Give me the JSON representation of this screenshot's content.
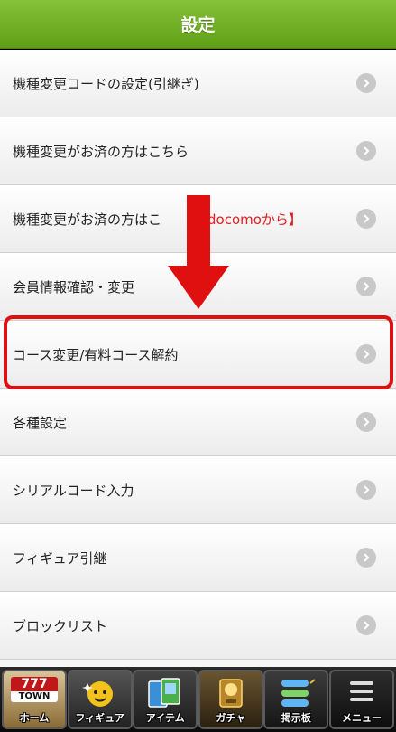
{
  "header": {
    "title": "設定"
  },
  "menu": {
    "items": [
      {
        "label": "機種変更コードの設定(引継ぎ)"
      },
      {
        "label": "機種変更がお済の方はこちら"
      },
      {
        "label": "機種変更がお済の方はこ",
        "extra": "【docomoから】"
      },
      {
        "label": "会員情報確認・変更"
      },
      {
        "label": "コース変更/有料コース解約"
      },
      {
        "label": "各種設定"
      },
      {
        "label": "シリアルコード入力"
      },
      {
        "label": "フィギュア引継"
      },
      {
        "label": "ブロックリスト"
      }
    ]
  },
  "tabbar": {
    "home": {
      "logo_top": "777",
      "logo_bottom": "TOWN",
      "label": "ホーム"
    },
    "figure": {
      "label": "フィギュア"
    },
    "item": {
      "label": "アイテム"
    },
    "gacha": {
      "label": "ガチャ"
    },
    "board": {
      "label": "掲示板"
    },
    "menu": {
      "label": "メニュー"
    }
  },
  "colors": {
    "header_green": "#6aab22",
    "highlight_red": "#e01010",
    "accent_red": "#e21d1d"
  }
}
